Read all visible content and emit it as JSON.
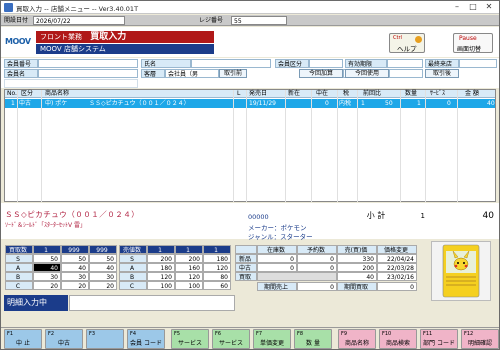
{
  "window": {
    "title": "買取入力 -- 店舗メニュー -- Ver3.40.01T"
  },
  "status": {
    "opdate_label": "開設日付",
    "opdate_value": "2026/07/22",
    "register_label": "レジ番号",
    "register_value": "55"
  },
  "header": {
    "logo": "MOOV",
    "red_label": "フロント業務",
    "red_title": "買取入力",
    "blue_label": "MOOV 店舗システム",
    "help_key": "Ctrl",
    "help_label": "ヘルプ",
    "pause_key": "Pause",
    "pause_label": "画面切替"
  },
  "info": {
    "member_no_label": "会員番号",
    "name_label": "氏名",
    "member_type_label": "会員区分",
    "valid_label": "有効期限",
    "last_visit_label": "最終来店",
    "member_label": "会員名",
    "customer_label": "客層",
    "customer_value": "会社員（男",
    "pull_button": "取引前",
    "add_points_label": "今回加算",
    "use_points_label": "今回使用",
    "pull_back_label": "取引後"
  },
  "grid": {
    "headers": [
      "No.",
      "区分",
      "商品名称",
      "L",
      "発売日",
      "新在",
      "中在",
      "税",
      "前回比",
      "数量",
      "ｻｰﾋﾞｽ",
      "金 額"
    ],
    "rows": [
      [
        "1",
        "中古",
        "中) ポケ",
        "ＳＳ◇ピカチュウ（００１／０２４）",
        "",
        "19/11/29",
        "",
        "0",
        "内税",
        "1",
        "50",
        "1",
        "0",
        "40"
      ]
    ]
  },
  "detail": {
    "product_name": "ＳＳ◇ピカチュウ（００１／０２４）",
    "product_sub": "ｿｰﾄﾞ＆ｼｰﾙﾄﾞ「ｽﾀｰﾀｰｾｯﾄV 雷」",
    "code": "00000",
    "maker": "メーカー：ポケモン",
    "genre": "ジャンル：スターター",
    "subtotal_label": "小 計",
    "subtotal_qty": "1",
    "subtotal_amount": "40"
  },
  "buy_table": {
    "header": [
      "買取数",
      "1",
      "999",
      "999"
    ],
    "rows": [
      [
        "S",
        "50",
        "50",
        "50"
      ],
      [
        "A",
        "40",
        "40",
        "40"
      ],
      [
        "B",
        "30",
        "30",
        "30"
      ],
      [
        "C",
        "20",
        "20",
        "20"
      ]
    ]
  },
  "sell_table": {
    "header": [
      "売値数",
      "1",
      "1",
      "1"
    ],
    "rows": [
      [
        "S",
        "200",
        "200",
        "180"
      ],
      [
        "A",
        "180",
        "160",
        "120"
      ],
      [
        "B",
        "120",
        "120",
        "80"
      ],
      [
        "C",
        "100",
        "100",
        "60"
      ]
    ]
  },
  "stock_table": {
    "headers": [
      "在庫数",
      "予約数",
      "売(買)価",
      "価格変更"
    ],
    "rows": [
      [
        "新品",
        "0",
        "0",
        "330",
        "22/04/24"
      ],
      [
        "中古",
        "0",
        "0",
        "200",
        "22/03/28"
      ],
      [
        "買取",
        "",
        "",
        "40",
        "23/02/16"
      ]
    ],
    "period_sales_label": "期間売上",
    "period_sales_value": "0",
    "period_buy_label": "期間買取",
    "period_buy_value": "0"
  },
  "note": {
    "label": "明細入力中"
  },
  "fkeys": [
    {
      "n": "F1",
      "l": "中 止",
      "c": "blue"
    },
    {
      "n": "F2",
      "l": "中古",
      "c": "blue"
    },
    {
      "n": "F3",
      "l": "",
      "c": "blue"
    },
    {
      "n": "F4",
      "l": "会員\nコード",
      "c": "blue"
    },
    {
      "n": "F5",
      "l": "サービス",
      "c": "green"
    },
    {
      "n": "F6",
      "l": "サービス",
      "c": "green"
    },
    {
      "n": "F7",
      "l": "単価変更",
      "c": "green"
    },
    {
      "n": "F8",
      "l": "数 量",
      "c": "green"
    },
    {
      "n": "F9",
      "l": "商品名称",
      "c": "pink"
    },
    {
      "n": "F10",
      "l": "商品検索",
      "c": "pink"
    },
    {
      "n": "F11",
      "l": "部門\nコード",
      "c": "pink"
    },
    {
      "n": "F12",
      "l": "明細確認",
      "c": "pink"
    }
  ]
}
